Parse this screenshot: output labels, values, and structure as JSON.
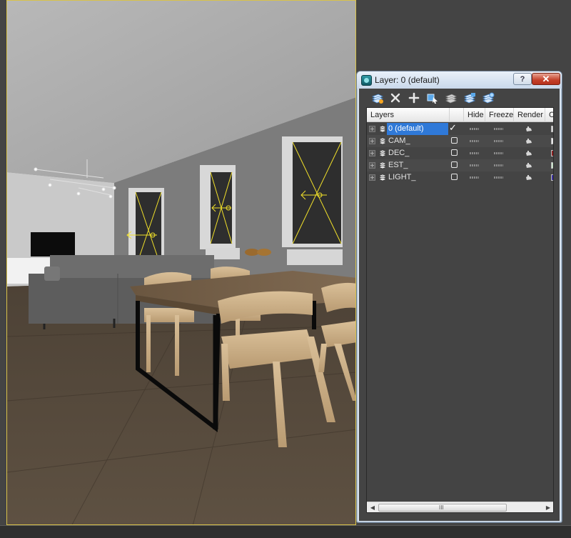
{
  "dialog": {
    "title": "Layer: 0 (default)",
    "help_label": "?",
    "close_label": "✕"
  },
  "toolbar": {
    "tools": [
      "create-new-layer-icon",
      "delete-layer-icon",
      "add-to-layer-icon",
      "select-objects-icon",
      "highlight-layer-icon",
      "hide-all-icon",
      "freeze-all-icon"
    ]
  },
  "columns": {
    "layers": "Layers",
    "hide": "Hide",
    "freeze": "Freeze",
    "render": "Render",
    "color": "Co"
  },
  "layers": [
    {
      "name": "0 (default)",
      "current": true,
      "swatch": "#d0d0d0"
    },
    {
      "name": "CAM_",
      "current": false,
      "swatch": "#e6e6e6"
    },
    {
      "name": "DEC_",
      "current": false,
      "swatch": "#8a2020"
    },
    {
      "name": "EST_",
      "current": false,
      "swatch": "#c8e0c8"
    },
    {
      "name": "LIGHT_",
      "current": false,
      "swatch": "#3a30a0"
    }
  ],
  "scrollbar": {
    "left_arrow": "◀",
    "right_arrow": "▶",
    "grip": "III"
  },
  "colors": {
    "selection": "#2f79d8",
    "viewport_border": "#d8c24a",
    "light_gizmo": "#f2e12a"
  }
}
